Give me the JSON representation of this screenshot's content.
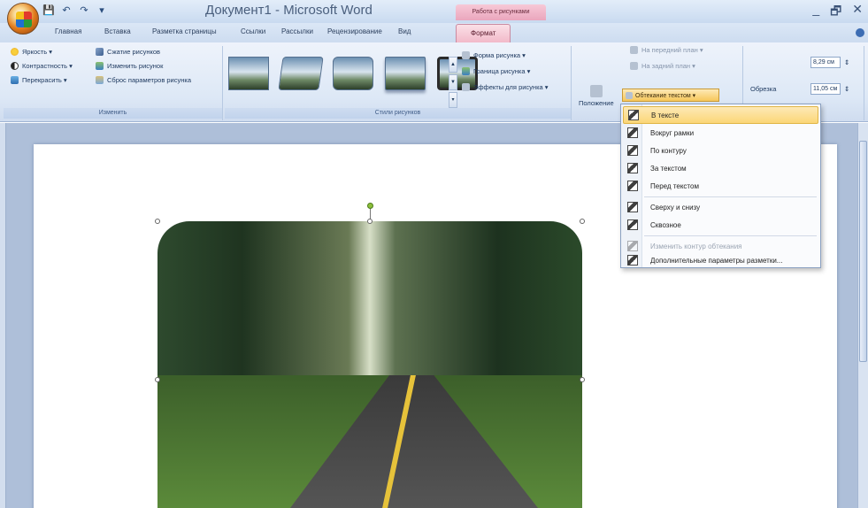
{
  "window": {
    "title": "Документ1 - Microsoft Word",
    "context_tab_title": "Работа с рисунками",
    "controls": [
      "_",
      "🗗",
      "✕"
    ]
  },
  "qat": [
    "💾",
    "↶",
    "↷",
    "▾"
  ],
  "tabs": [
    "Главная",
    "Вставка",
    "Разметка страницы",
    "Ссылки",
    "Рассылки",
    "Рецензирование",
    "Вид",
    "Формат"
  ],
  "ribbon": {
    "adjust": {
      "label": "Изменить",
      "brightness": "Яркость ▾",
      "contrast": "Контрастность ▾",
      "recolor": "Перекрасить ▾",
      "compress": "Сжатие рисунков",
      "change_picture": "Изменить рисунок",
      "reset": "Сброс параметров рисунка"
    },
    "styles": {
      "label": "Стили рисунков",
      "shape": "Форма рисунка ▾",
      "border": "Граница рисунка ▾",
      "effects": "Эффекты для рисунка ▾"
    },
    "arrange": {
      "position": "Положение",
      "bring_front": "На передний план ▾",
      "send_back": "На задний план ▾",
      "text_wrap": "Обтекание текстом ▾"
    },
    "size": {
      "crop": "Обрезка",
      "height": "8,29 см",
      "width": "11,05 см"
    }
  },
  "menu": {
    "items": [
      {
        "label": "В тексте",
        "state": "highlight"
      },
      {
        "label": "Вокруг рамки",
        "state": "normal"
      },
      {
        "label": "По контуру",
        "state": "normal"
      },
      {
        "label": "За текстом",
        "state": "normal"
      },
      {
        "label": "Перед текстом",
        "state": "normal"
      },
      {
        "label": "Сверху и снизу",
        "state": "normal"
      },
      {
        "label": "Сквозное",
        "state": "normal"
      },
      {
        "label": "Изменить контур обтекания",
        "state": "disabled"
      },
      {
        "label": "Дополнительные параметры разметки...",
        "state": "normal"
      }
    ]
  }
}
